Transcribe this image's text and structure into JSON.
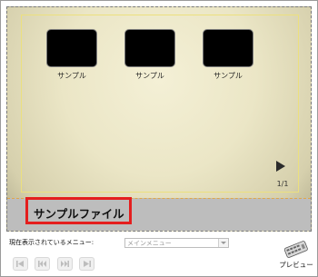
{
  "menu_stage": {
    "thumbnails": [
      {
        "caption": "サンプル"
      },
      {
        "caption": "サンプル"
      },
      {
        "caption": "サンプル"
      }
    ],
    "page_indicator": "1/1",
    "title": "サンプルファイル"
  },
  "controls": {
    "current_menu_label": "現在表示されているメニュー:",
    "menu_select_value": "メインメニュー",
    "preview_label": "プレビュー"
  },
  "icons": {
    "next": "next-page-arrow-icon",
    "first": "first-icon",
    "prev": "previous-icon",
    "next_nav": "next-icon",
    "last": "last-icon",
    "remote": "remote-control-icon"
  },
  "colors": {
    "highlight_border": "#e41e1e",
    "safe_area": "#ece07e",
    "title_bar": "#bdbdbd"
  }
}
